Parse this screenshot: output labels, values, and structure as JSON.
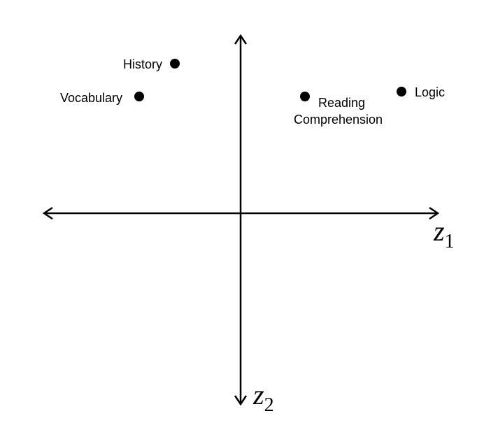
{
  "axes": {
    "horizontal": {
      "symbol": "z",
      "subscript": "1"
    },
    "vertical": {
      "symbol": "z",
      "subscript": "2"
    }
  },
  "points": [
    {
      "id": "history",
      "label_lines": [
        "History"
      ]
    },
    {
      "id": "vocabulary",
      "label_lines": [
        "Vocabulary"
      ]
    },
    {
      "id": "reading",
      "label_lines": [
        "Reading",
        "Comprehension"
      ]
    },
    {
      "id": "logic",
      "label_lines": [
        "Logic"
      ]
    }
  ],
  "colors": {
    "ink": "#000000",
    "background": "#ffffff"
  }
}
